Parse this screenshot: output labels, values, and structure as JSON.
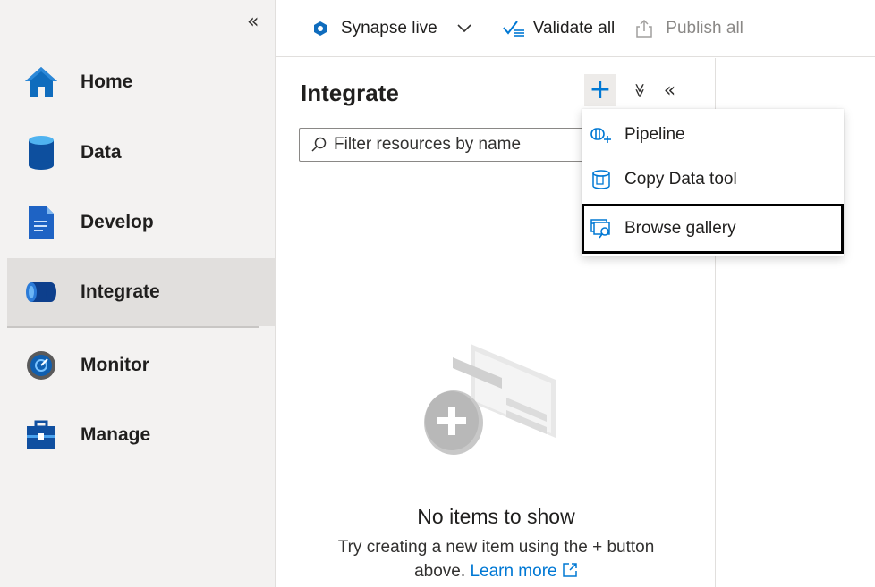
{
  "nav": {
    "collapse_icon": "«",
    "items": [
      {
        "label": "Home",
        "icon": "home-icon"
      },
      {
        "label": "Data",
        "icon": "data-icon"
      },
      {
        "label": "Develop",
        "icon": "develop-icon"
      },
      {
        "label": "Integrate",
        "icon": "integrate-icon",
        "active": true
      },
      {
        "label": "Monitor",
        "icon": "monitor-icon"
      },
      {
        "label": "Manage",
        "icon": "manage-icon"
      }
    ]
  },
  "toolbar": {
    "workspace_label": "Synapse live",
    "validate_label": "Validate all",
    "publish_label": "Publish all"
  },
  "pane": {
    "title": "Integrate",
    "add_symbol": "+",
    "expand_symbol": "≫",
    "collapse_symbol": "«",
    "filter_placeholder": "Filter resources by name",
    "filter_value": "",
    "empty_title": "No items to show",
    "empty_desc": "Try creating a new item using the + button above.",
    "learn_more": "Learn more"
  },
  "menu": {
    "items": [
      {
        "label": "Pipeline",
        "icon": "pipeline-icon"
      },
      {
        "label": "Copy Data tool",
        "icon": "copy-data-icon"
      },
      {
        "label": "Browse gallery",
        "icon": "gallery-icon",
        "highlighted": true
      }
    ]
  },
  "colors": {
    "accent": "#0078d4",
    "nav_bg": "#f3f2f1",
    "active_bg": "#e1dfdd",
    "highlight_border": "#000000"
  }
}
